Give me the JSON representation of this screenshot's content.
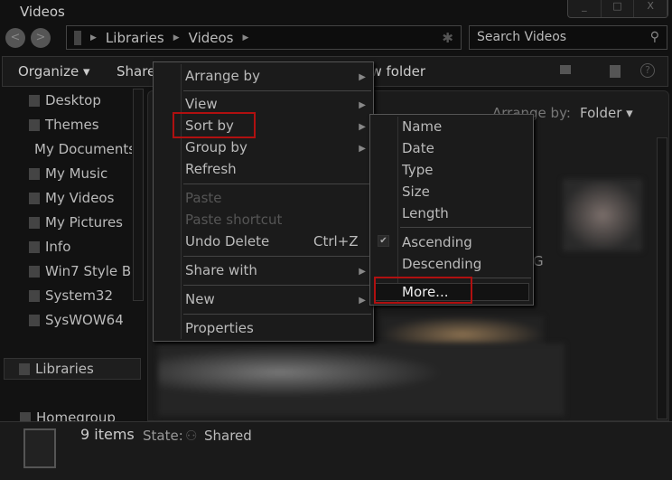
{
  "window": {
    "title": "Videos",
    "controls": [
      "_",
      "□",
      "X"
    ]
  },
  "address": {
    "back": "<",
    "forward": ">",
    "crumbs": [
      "Libraries",
      "Videos"
    ]
  },
  "search": {
    "placeholder": "Search Videos"
  },
  "toolbar": {
    "organize": "Organize ▾",
    "share": "Share",
    "new_folder": "New folder"
  },
  "sidebar": {
    "items": [
      "Desktop",
      "Themes",
      "My Documents",
      "My Music",
      "My Videos",
      "My Pictures",
      "Info",
      "Win7 Style B",
      "System32",
      "SysWOW64"
    ],
    "libraries": "Libraries",
    "homegroup": "Homegroup"
  },
  "content": {
    "arrange_label": "Arrange by:",
    "arrange_value": "Folder ▾",
    "partial_label": "G"
  },
  "status": {
    "count": "9 items",
    "state_label": "State:",
    "state_value": "Shared"
  },
  "context_menu": {
    "items": [
      {
        "label": "Arrange by",
        "submenu": true
      },
      {
        "label": "View",
        "submenu": true
      },
      {
        "label": "Sort by",
        "submenu": true,
        "highlighted": true
      },
      {
        "label": "Group by",
        "submenu": true
      },
      {
        "label": "Refresh"
      },
      {
        "label": "Paste",
        "disabled": true
      },
      {
        "label": "Paste shortcut",
        "disabled": true
      },
      {
        "label": "Undo Delete",
        "shortcut": "Ctrl+Z"
      },
      {
        "label": "Share with",
        "submenu": true
      },
      {
        "label": "New",
        "submenu": true
      },
      {
        "label": "Properties"
      }
    ]
  },
  "sort_submenu": {
    "items": [
      "Name",
      "Date",
      "Type",
      "Size",
      "Length",
      "Ascending",
      "Descending",
      "More..."
    ],
    "checked": "Ascending"
  }
}
